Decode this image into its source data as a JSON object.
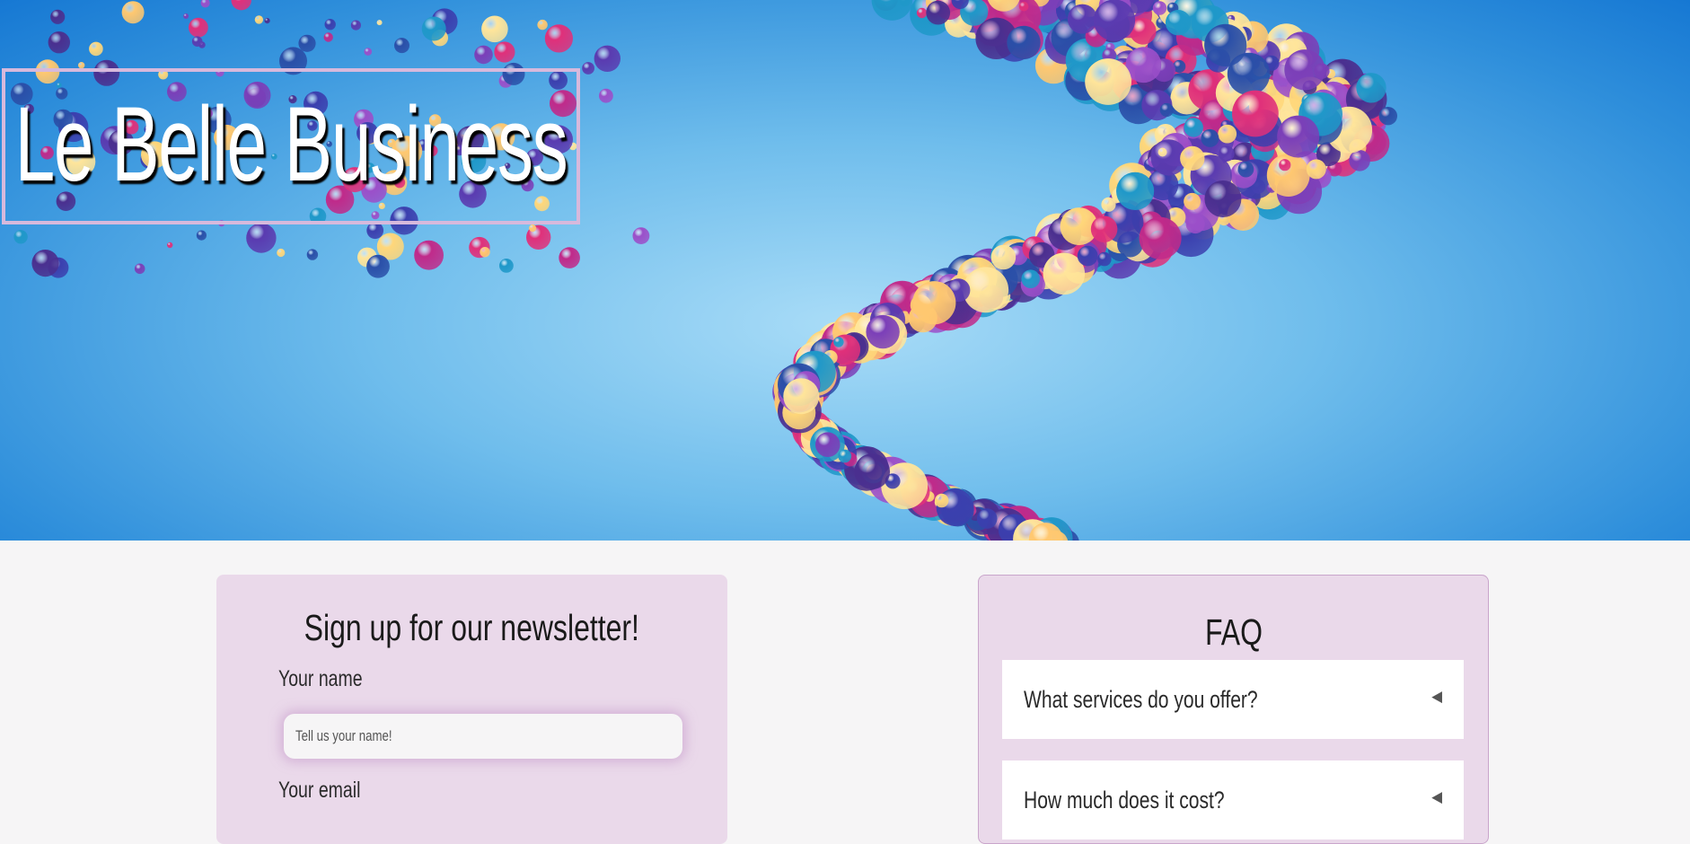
{
  "hero": {
    "title": "Le Belle Business"
  },
  "newsletter": {
    "heading": "Sign up for our newsletter!",
    "name_label": "Your name",
    "name_placeholder": "Tell us your name!",
    "email_label": "Your email"
  },
  "faq": {
    "heading": "FAQ",
    "items": [
      {
        "question": "What services do you offer?",
        "icon": "triangle-left-icon"
      },
      {
        "question": "How much does it cost?",
        "icon": "triangle-left-icon"
      }
    ]
  },
  "colors": {
    "hero_sky": "#6fbdec",
    "card_background": "#ead9ea",
    "title_border": "#d7b9dc",
    "page_background": "#f6f5f6"
  }
}
